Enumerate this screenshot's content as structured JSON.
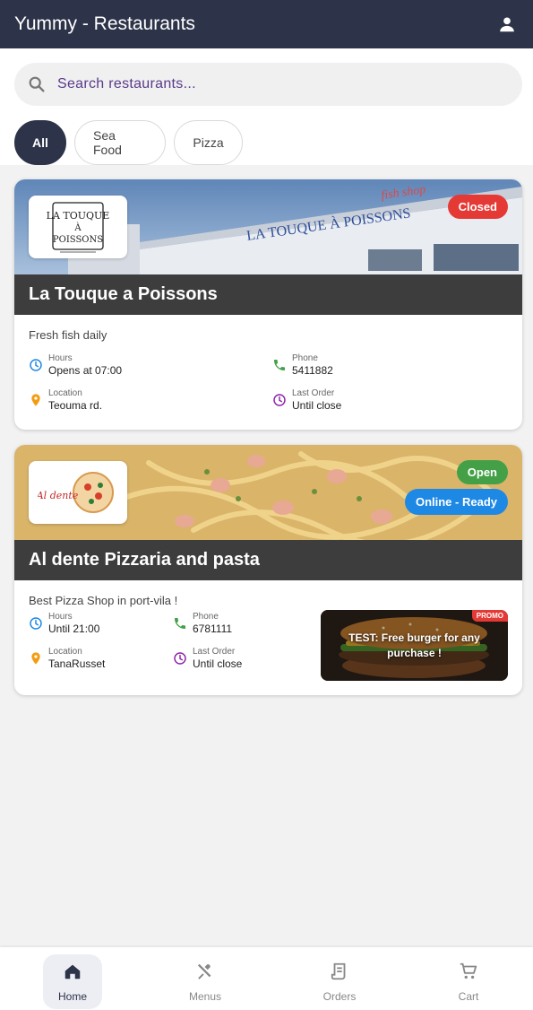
{
  "app": {
    "title": "Yummy - Restaurants"
  },
  "search": {
    "placeholder": "Search restaurants..."
  },
  "filters": [
    {
      "label": "All",
      "active": true
    },
    {
      "label": "Sea Food",
      "active": false
    },
    {
      "label": "Pizza",
      "active": false
    }
  ],
  "restaurants": [
    {
      "name": "La Touque a Poissons",
      "status": "Closed",
      "description": "Fresh fish daily",
      "hours_label": "Hours",
      "hours_value": "Opens at 07:00",
      "phone_label": "Phone",
      "phone_value": "5411882",
      "location_label": "Location",
      "location_value": "Teouma rd.",
      "last_order_label": "Last Order",
      "last_order_value": "Until close"
    },
    {
      "name": "Al dente Pizzaria and pasta",
      "status": "Open",
      "online": "Online - Ready",
      "description": "Best Pizza Shop in port-vila !",
      "hours_label": "Hours",
      "hours_value": "Until 21:00",
      "phone_label": "Phone",
      "phone_value": "6781111",
      "location_label": "Location",
      "location_value": "TanaRusset",
      "last_order_label": "Last Order",
      "last_order_value": "Until close",
      "promo": {
        "tag": "PROMO",
        "text": "TEST: Free burger for any purchase !"
      }
    }
  ],
  "nav": [
    {
      "label": "Home",
      "icon": "home-icon",
      "active": true
    },
    {
      "label": "Menus",
      "icon": "fork-knife-icon",
      "active": false
    },
    {
      "label": "Orders",
      "icon": "receipt-icon",
      "active": false
    },
    {
      "label": "Cart",
      "icon": "cart-icon",
      "active": false
    }
  ],
  "colors": {
    "primary": "#2d3349",
    "closed": "#e53935",
    "open": "#43a047",
    "online": "#1e88e5"
  }
}
